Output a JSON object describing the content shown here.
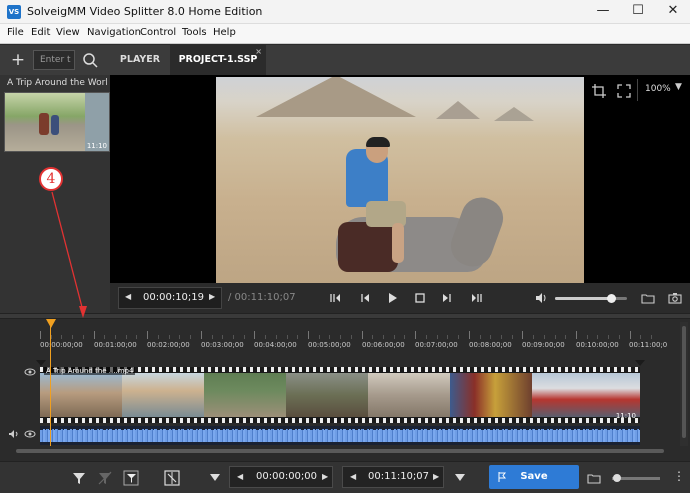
{
  "window": {
    "title": "SolveigMM Video Splitter 8.0 Home Edition",
    "logo_text": "VS",
    "controls": {
      "minimize": "—",
      "maximize": "☐",
      "close": "✕"
    }
  },
  "menu": [
    "File",
    "Edit",
    "View",
    "Navigation",
    "Control",
    "Tools",
    "Help"
  ],
  "library": {
    "add_label": "+",
    "search_placeholder": "Enter t",
    "clip_title": "A Trip Around the World...",
    "clip_duration": "11:10"
  },
  "tabs": [
    {
      "label": "PLAYER",
      "active": false
    },
    {
      "label": "PROJECT-1.SSP",
      "active": true,
      "close": "×"
    }
  ],
  "player": {
    "zoom": "100%",
    "zoom_arrow": "▼",
    "current_time": "00:00:10;19",
    "total_time": "/ 00:11:10;07",
    "volume_level": 0.78
  },
  "timeline": {
    "ticks": [
      "00:00:00;00",
      "00:01:00;00",
      "00:02:00;00",
      "00:03:00;00",
      "00:04:00;00",
      "00:05:00;00",
      "00:06:00;00",
      "00:07:00;00",
      "00:08:00;00",
      "00:09:00;00",
      "00:10:00;00",
      "00:11:00;0"
    ],
    "track_title": "A Trip Around the ....mp4",
    "track_duration": "11:10"
  },
  "bottom_toolbar": {
    "start_time": "00:00:00;00",
    "end_time": "00:11:10;07",
    "save_label": "Save",
    "zoom_level": 0.1,
    "more": "⋮"
  },
  "annotation": {
    "number": "4"
  },
  "colors": {
    "accent": "#2e7bd6",
    "playhead": "#f0a020",
    "annotation": "#e23232",
    "waveform": "#6f9ee6"
  }
}
